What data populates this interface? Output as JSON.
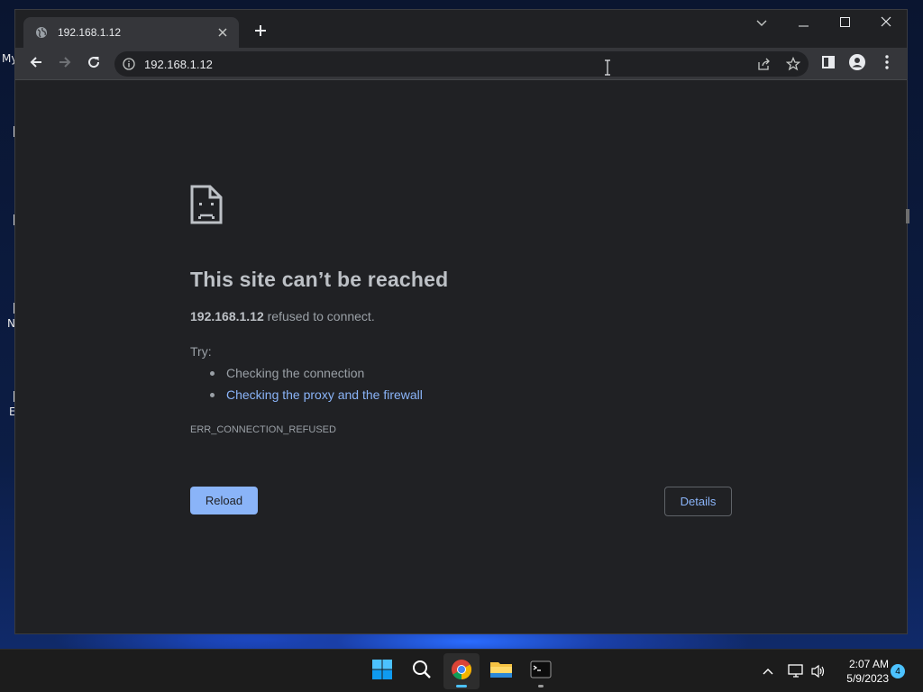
{
  "desktop": {
    "icon_fragments": [
      "My",
      "N",
      "E"
    ]
  },
  "browser": {
    "tab": {
      "title": "192.168.1.12",
      "favicon": "globe-icon",
      "close_icon": "close-icon"
    },
    "new_tab_icon": "plus-icon",
    "window_controls": [
      "chevron-down-icon",
      "minimize-icon",
      "maximize-icon",
      "close-icon"
    ],
    "toolbar": {
      "back_icon": "arrow-left-icon",
      "forward_icon": "arrow-right-icon",
      "reload_icon": "reload-icon",
      "site_info_icon": "info-icon",
      "url": "192.168.1.12",
      "share_icon": "share-icon",
      "bookmark_icon": "star-icon",
      "side_panel_icon": "side-panel-icon",
      "profile_icon": "profile-icon",
      "menu_icon": "kebab-menu-icon"
    },
    "error_page": {
      "icon": "sad-document-icon",
      "title": "This site can’t be reached",
      "host": "192.168.1.12",
      "description": " refused to connect.",
      "try_label": "Try:",
      "suggestions": [
        {
          "text": "Checking the connection",
          "link": false
        },
        {
          "text": "Checking the proxy and the firewall",
          "link": true
        }
      ],
      "error_code": "ERR_CONNECTION_REFUSED",
      "reload_label": "Reload",
      "details_label": "Details"
    }
  },
  "taskbar": {
    "apps": [
      {
        "name": "start",
        "icon": "windows-logo-icon"
      },
      {
        "name": "search",
        "icon": "search-icon"
      },
      {
        "name": "chrome",
        "icon": "chrome-icon",
        "active": true
      },
      {
        "name": "file-explorer",
        "icon": "folder-icon"
      },
      {
        "name": "terminal",
        "icon": "terminal-icon"
      }
    ],
    "tray": {
      "overflow_icon": "chevron-up-icon",
      "network_icon": "network-icon",
      "volume_icon": "speaker-icon"
    },
    "clock": {
      "time": "2:07 AM",
      "date": "5/9/2023"
    },
    "notification_count": "4"
  },
  "colors": {
    "accent_blue": "#8ab4f8",
    "chrome_bg": "#202124",
    "toolbar_bg": "#35363a",
    "taskbar_bg": "#1c1c1c",
    "badge": "#4cc2ff"
  }
}
